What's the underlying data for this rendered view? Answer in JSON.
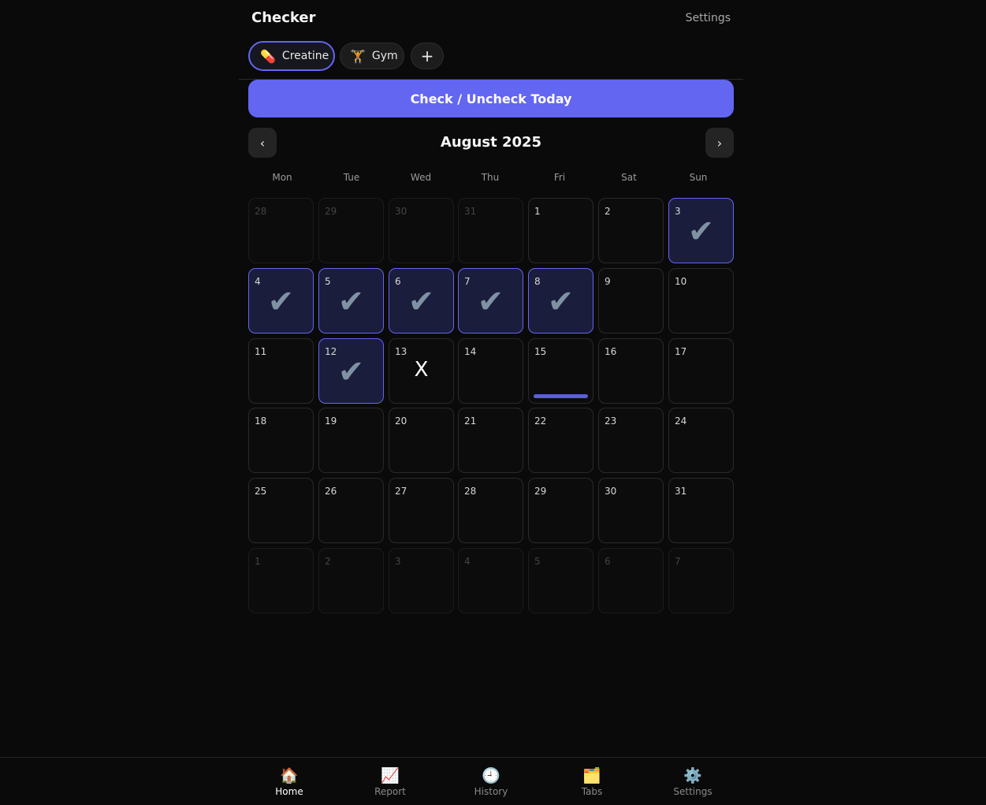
{
  "header": {
    "title": "Checker",
    "settings_label": "Settings"
  },
  "tabs": [
    {
      "label": "Creatine",
      "icon": "💊",
      "icon_name": "pill-icon",
      "active": true
    },
    {
      "label": "Gym",
      "icon": "🏋",
      "icon_name": "weightlifter-icon",
      "active": false
    }
  ],
  "add_tab_label": "+",
  "check_button_label": "Check / Uncheck Today",
  "calendar": {
    "month_label": "August 2025",
    "prev_label": "‹",
    "next_label": "›",
    "weekdays": [
      "Mon",
      "Tue",
      "Wed",
      "Thu",
      "Fri",
      "Sat",
      "Sun"
    ],
    "check_symbol": "✔",
    "x_symbol": "X",
    "accent_color": "#6366f1",
    "days": [
      {
        "n": "28",
        "out": true
      },
      {
        "n": "29",
        "out": true
      },
      {
        "n": "30",
        "out": true
      },
      {
        "n": "31",
        "out": true
      },
      {
        "n": "1"
      },
      {
        "n": "2"
      },
      {
        "n": "3",
        "checked": true
      },
      {
        "n": "4",
        "checked": true
      },
      {
        "n": "5",
        "checked": true
      },
      {
        "n": "6",
        "checked": true
      },
      {
        "n": "7",
        "checked": true
      },
      {
        "n": "8",
        "checked": true
      },
      {
        "n": "9"
      },
      {
        "n": "10"
      },
      {
        "n": "11"
      },
      {
        "n": "12",
        "checked": true
      },
      {
        "n": "13",
        "x": true
      },
      {
        "n": "14"
      },
      {
        "n": "15",
        "today": true
      },
      {
        "n": "16"
      },
      {
        "n": "17"
      },
      {
        "n": "18"
      },
      {
        "n": "19"
      },
      {
        "n": "20"
      },
      {
        "n": "21"
      },
      {
        "n": "22"
      },
      {
        "n": "23"
      },
      {
        "n": "24"
      },
      {
        "n": "25"
      },
      {
        "n": "26"
      },
      {
        "n": "27"
      },
      {
        "n": "28"
      },
      {
        "n": "29"
      },
      {
        "n": "30"
      },
      {
        "n": "31"
      },
      {
        "n": "1",
        "out": true
      },
      {
        "n": "2",
        "out": true
      },
      {
        "n": "3",
        "out": true
      },
      {
        "n": "4",
        "out": true
      },
      {
        "n": "5",
        "out": true
      },
      {
        "n": "6",
        "out": true
      },
      {
        "n": "7",
        "out": true
      }
    ]
  },
  "bottom_nav": [
    {
      "label": "Home",
      "icon": "🏠",
      "icon_name": "home-icon",
      "active": true
    },
    {
      "label": "Report",
      "icon": "📈",
      "icon_name": "chart-icon",
      "active": false
    },
    {
      "label": "History",
      "icon": "🕘",
      "icon_name": "clock-icon",
      "active": false
    },
    {
      "label": "Tabs",
      "icon": "🗂️",
      "icon_name": "folder-icon",
      "active": false
    },
    {
      "label": "Settings",
      "icon": "⚙️",
      "icon_name": "gear-icon",
      "active": false
    }
  ]
}
